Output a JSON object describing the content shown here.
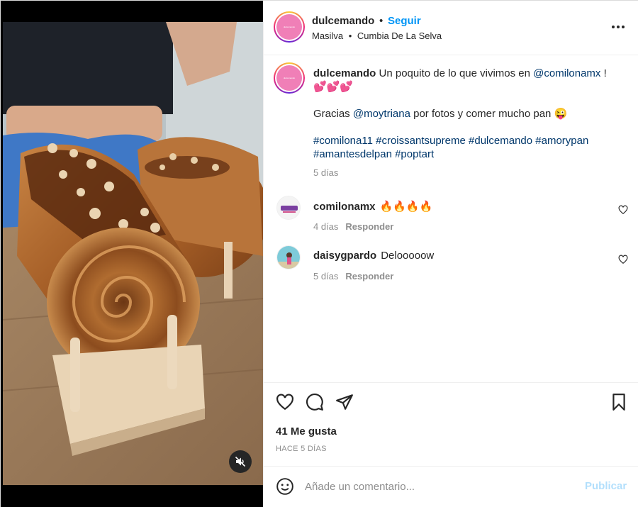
{
  "post": {
    "username": "dulcemando",
    "separator": "•",
    "follow_label": "Seguir",
    "location": "Masilva",
    "audio_separator": "•",
    "audio": "Cumbia De La Selva",
    "avatar_text": "dulcemando"
  },
  "caption": {
    "username": "dulcemando",
    "text1": " Un poquito de lo que vivimos en ",
    "mention1": "@comilonamx",
    "text2": " !",
    "hearts": "💕💕💕",
    "line2_start": "Gracias ",
    "mention2": "@moytriana",
    "line2_end": " por fotos y comer mucho pan 😜",
    "hashtags": [
      "#comilona11",
      "#croissantsupreme",
      "#dulcemando",
      "#amorypan",
      "#amantesdelpan",
      "#poptart"
    ],
    "time": "5 días"
  },
  "comments": [
    {
      "username": "comilonamx",
      "text": "🔥🔥🔥🔥",
      "time": "4 días",
      "reply_label": "Responder"
    },
    {
      "username": "daisygpardo",
      "text": "Delooooow",
      "time": "5 días",
      "reply_label": "Responder"
    }
  ],
  "actions": {
    "likes": "41 Me gusta",
    "posted_ago": "HACE 5 DÍAS"
  },
  "composer": {
    "placeholder": "Añade un comentario...",
    "post_label": "Publicar"
  },
  "colors": {
    "accent": "#0095f6",
    "link": "#00376b",
    "muted": "#8e8e8e",
    "post_disabled": "#b2dffc"
  }
}
